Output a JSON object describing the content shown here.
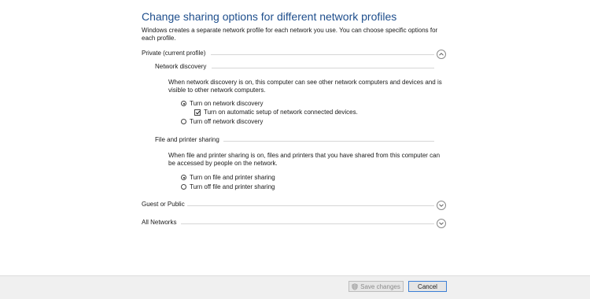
{
  "title": "Change sharing options for different network profiles",
  "intro": "Windows creates a separate network profile for each network you use. You can choose specific options for each profile.",
  "private": {
    "label": "Private (current profile)",
    "expanded": true,
    "network_discovery": {
      "label": "Network discovery",
      "description": "When network discovery is on, this computer can see other network computers and devices and is visible to other network computers.",
      "on_label": "Turn on network discovery",
      "auto_setup_label": "Turn on automatic setup of network connected devices.",
      "off_label": "Turn off network discovery",
      "selected": "on",
      "auto_setup_checked": true
    },
    "file_printer": {
      "label": "File and printer sharing",
      "description": "When file and printer sharing is on, files and printers that you have shared from this computer can be accessed by people on the network.",
      "on_label": "Turn on file and printer sharing",
      "off_label": "Turn off file and printer sharing",
      "selected": "on"
    }
  },
  "guest": {
    "label": "Guest or Public",
    "expanded": false
  },
  "all_networks": {
    "label": "All Networks",
    "expanded": false
  },
  "footer": {
    "save_label": "Save changes",
    "save_enabled": false,
    "cancel_label": "Cancel"
  },
  "icons": {
    "chevron_up": "chevron-up-icon",
    "chevron_down": "chevron-down-icon",
    "shield": "uac-shield-icon"
  },
  "colors": {
    "title": "#1e4e8c",
    "footer_bg": "#f0f0f0",
    "cancel_border": "#3c7fd6"
  }
}
